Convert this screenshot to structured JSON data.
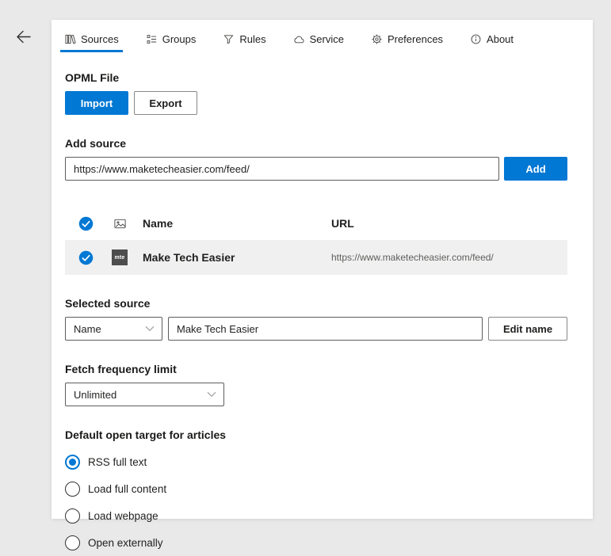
{
  "window": {
    "active_tab": "Sources"
  },
  "tabs": [
    {
      "label": "Sources",
      "icon": "sources-icon"
    },
    {
      "label": "Groups",
      "icon": "groups-icon"
    },
    {
      "label": "Rules",
      "icon": "rules-icon"
    },
    {
      "label": "Service",
      "icon": "service-icon"
    },
    {
      "label": "Preferences",
      "icon": "preferences-icon"
    },
    {
      "label": "About",
      "icon": "about-icon"
    }
  ],
  "opml": {
    "heading": "OPML File",
    "import_label": "Import",
    "export_label": "Export"
  },
  "add_source": {
    "label": "Add source",
    "input_value": "https://www.maketecheasier.com/feed/",
    "add_label": "Add"
  },
  "table": {
    "columns": {
      "name": "Name",
      "url": "URL"
    },
    "select_all_checked": true,
    "rows": [
      {
        "name": "Make Tech Easier",
        "url": "https://www.maketecheasier.com/feed/",
        "favicon_text": "mte",
        "checked": true,
        "selected": true
      }
    ]
  },
  "selected_source": {
    "label": "Selected source",
    "dropdown_value": "Name",
    "name_value": "Make Tech Easier",
    "edit_button": "Edit name"
  },
  "fetch_frequency": {
    "label": "Fetch frequency limit",
    "value": "Unlimited"
  },
  "open_target": {
    "label": "Default open target for articles",
    "options": [
      {
        "label": "RSS full text",
        "selected": true
      },
      {
        "label": "Load full content",
        "selected": false
      },
      {
        "label": "Load webpage",
        "selected": false
      },
      {
        "label": "Open externally",
        "selected": false
      }
    ]
  },
  "colors": {
    "accent": "#0078d4",
    "card_bg": "#ffffff",
    "page_bg": "#e9e9e9",
    "selected_row_bg": "#f0f0f0"
  }
}
